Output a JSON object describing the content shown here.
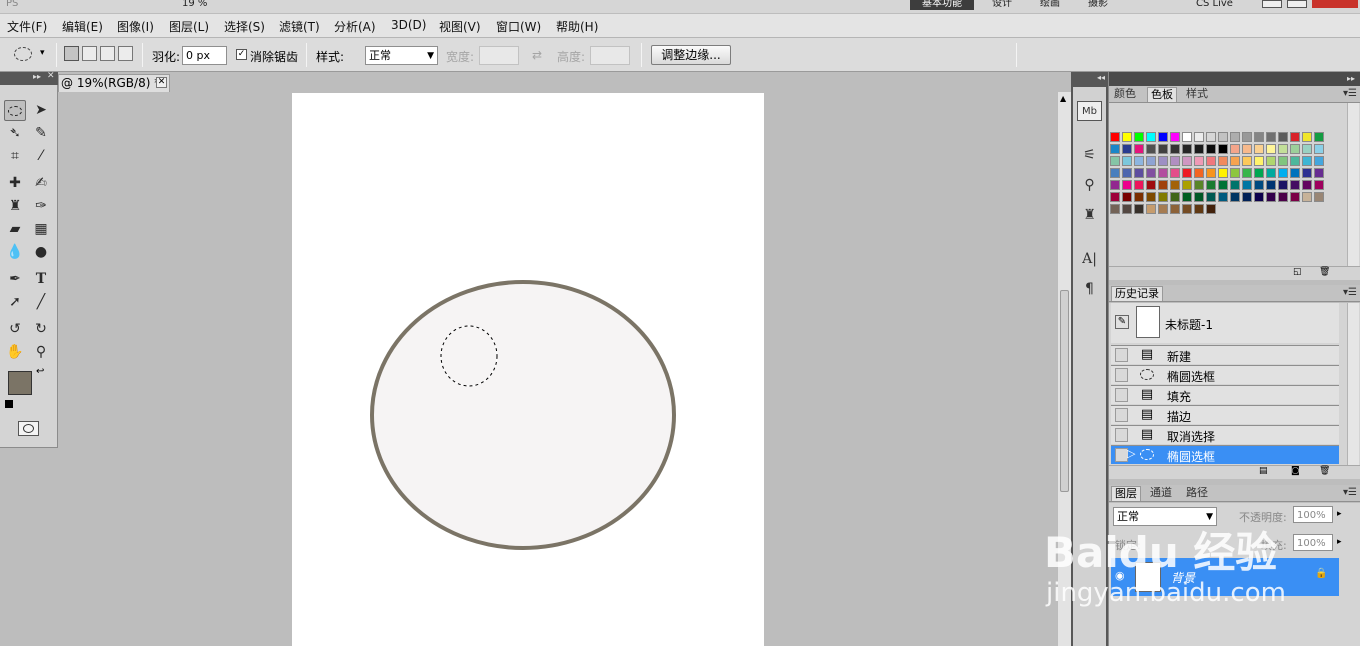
{
  "app": {
    "title_fragment": "PS",
    "workspace_buttons": [
      "基本功能",
      "设计",
      "绘画",
      "摄影"
    ],
    "cs_live": "CS Live",
    "zoom_fragment": "19 %"
  },
  "menubar": {
    "items": [
      "文件(F)",
      "编辑(E)",
      "图像(I)",
      "图层(L)",
      "选择(S)",
      "滤镜(T)",
      "分析(A)",
      "3D(D)",
      "视图(V)",
      "窗口(W)",
      "帮助(H)"
    ]
  },
  "options_bar": {
    "feather_label": "羽化:",
    "feather_value": "0 px",
    "antialias_label": "消除锯齿",
    "antialias_checked": true,
    "style_label": "样式:",
    "style_value": "正常",
    "width_label": "宽度:",
    "height_label": "高度:",
    "refine_button": "调整边缘..."
  },
  "document": {
    "tab_title": "@ 19%(RGB/8) *",
    "ellipse_fill": "#f6f4f4",
    "ellipse_stroke": "#7b7466",
    "foreground_color": "#7b7466",
    "background_color": "#ffffff"
  },
  "swatches_panel": {
    "tabs": [
      "颜色",
      "色板",
      "样式"
    ],
    "active_tab": "色板",
    "colors": [
      [
        "#ff0000",
        "#ffff00",
        "#00ff00",
        "#00ffff",
        "#0000ff",
        "#ff00ff",
        "#ffffff",
        "#ebebeb",
        "#d6d6d6",
        "#c2c2c2",
        "#adadad",
        "#999999",
        "#858585",
        "#707070",
        "#5c5c5c",
        "#d8232a",
        "#f0e52a",
        "#149c42"
      ],
      [
        "#1b86c8",
        "#2a3c8f",
        "#e3137c",
        "#505050",
        "#404040",
        "#333333",
        "#262626",
        "#1a1a1a",
        "#0d0d0d",
        "#000000",
        "#f4a58a",
        "#f7b98c",
        "#fbd191",
        "#fff599",
        "#c3df99",
        "#9dcf9a",
        "#99d1c2",
        "#8bd0e7"
      ],
      [
        "#85c5a6",
        "#7cc8dc",
        "#8db5e0",
        "#8ea3d3",
        "#9d8fc4",
        "#b18fc2",
        "#d097c2",
        "#ef9ab6",
        "#f0787d",
        "#f08a5d",
        "#f6a34f",
        "#fcc95b",
        "#fff36b",
        "#afd56e",
        "#80c57f",
        "#4db79c",
        "#3fb5d4",
        "#44a6dd"
      ],
      [
        "#4a7fbe",
        "#4e66ae",
        "#5d4e9f",
        "#8150a0",
        "#b24e9f",
        "#e34e8a",
        "#ed1c24",
        "#f26522",
        "#f7941d",
        "#fff200",
        "#8dc63f",
        "#39b54a",
        "#00a651",
        "#00a99d",
        "#00aeef",
        "#0072bc",
        "#2e3192",
        "#662d91"
      ],
      [
        "#92278f",
        "#ec008c",
        "#ed145b",
        "#9e0b0f",
        "#a0410d",
        "#a3620a",
        "#aba000",
        "#598527",
        "#197b30",
        "#007236",
        "#00746b",
        "#0076a3",
        "#004a80",
        "#003471",
        "#1b1464",
        "#440e62",
        "#630460",
        "#9e005d"
      ],
      [
        "#9e0039",
        "#790000",
        "#7b2e00",
        "#7d4900",
        "#827b00",
        "#406618",
        "#005e20",
        "#005826",
        "#005952",
        "#005b7f",
        "#003663",
        "#002157",
        "#0d004c",
        "#32004b",
        "#4b0049",
        "#7b0046",
        "#c7b299",
        "#998675"
      ],
      [
        "#736357",
        "#534741",
        "#37302a",
        "#c69c6d",
        "#a67c52",
        "#8c6239",
        "#754c24",
        "#603913",
        "#42210b"
      ]
    ]
  },
  "history_panel": {
    "title": "历史记录",
    "snapshot": "未标题-1",
    "items": [
      {
        "label": "新建",
        "icon": "doc-icon"
      },
      {
        "label": "椭圆选框",
        "icon": "ellipse-marquee-icon"
      },
      {
        "label": "填充",
        "icon": "doc-icon"
      },
      {
        "label": "描边",
        "icon": "doc-icon"
      },
      {
        "label": "取消选择",
        "icon": "doc-icon"
      },
      {
        "label": "椭圆选框",
        "icon": "ellipse-marquee-icon",
        "selected": true
      }
    ]
  },
  "layers_panel": {
    "tabs": [
      "图层",
      "通道",
      "路径"
    ],
    "active_tab": "图层",
    "blend_mode": "正常",
    "opacity_label": "不透明度:",
    "opacity": "100%",
    "fill_label": "填充:",
    "fill": "100%",
    "layer_name": "背景",
    "lock_label": "锁定:"
  },
  "watermark": {
    "logo": "Baidu 经验",
    "url": "jingyan.baidu.com"
  }
}
